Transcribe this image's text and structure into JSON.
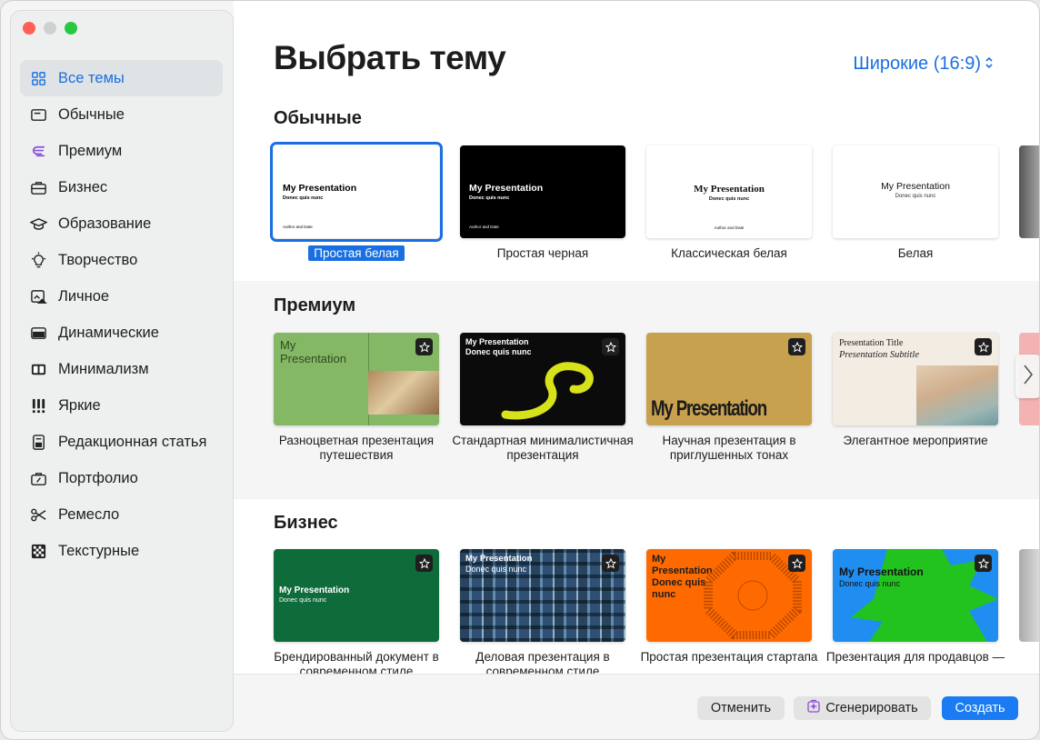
{
  "window": {
    "traffic_lights": [
      "close",
      "minimize",
      "maximize"
    ]
  },
  "sidebar": {
    "items": [
      {
        "label": "Все темы",
        "icon": "grid-icon"
      },
      {
        "label": "Обычные",
        "icon": "window-icon"
      },
      {
        "label": "Премиум",
        "icon": "premium-e-icon"
      },
      {
        "label": "Бизнес",
        "icon": "briefcase-icon"
      },
      {
        "label": "Образование",
        "icon": "graduation-cap-icon"
      },
      {
        "label": "Творчество",
        "icon": "lightbulb-icon"
      },
      {
        "label": "Личное",
        "icon": "personal-photo-icon"
      },
      {
        "label": "Динамические",
        "icon": "dynamic-slide-icon"
      },
      {
        "label": "Минимализм",
        "icon": "minimal-panels-icon"
      },
      {
        "label": "Яркие",
        "icon": "exclamation-icon"
      },
      {
        "label": "Редакционная статья",
        "icon": "document-icon"
      },
      {
        "label": "Портфолио",
        "icon": "portfolio-icon"
      },
      {
        "label": "Ремесло",
        "icon": "scissors-icon"
      },
      {
        "label": "Текстурные",
        "icon": "checkerboard-icon"
      }
    ]
  },
  "header": {
    "title": "Выбрать тему",
    "ratio": "Широкие (16:9)"
  },
  "sections": {
    "basic": {
      "title": "Обычные",
      "cards": [
        {
          "caption": "Простая белая",
          "t_title": "My Presentation",
          "t_sub": "Donec quis nunc",
          "t_foot": "Author and Date"
        },
        {
          "caption": "Простая черная",
          "t_title": "My Presentation",
          "t_sub": "Donec quis nunc",
          "t_foot": "Author and Date"
        },
        {
          "caption": "Классическая белая",
          "t_title": "My Presentation",
          "t_sub": "Donec quis nunc",
          "t_foot": "Author and Date"
        },
        {
          "caption": "Белая",
          "t_title": "My Presentation",
          "t_sub": "Donec quis nunc"
        }
      ]
    },
    "premium": {
      "title": "Премиум",
      "cards": [
        {
          "caption": "Разноцветная презентация путешествия",
          "t_title": "My Presentation"
        },
        {
          "caption": "Стандартная минималистичная презентация",
          "t_title": "My Presentation",
          "t_sub": "Donec quis nunc"
        },
        {
          "caption": "Научная презентация в приглушенных тонах",
          "t_title": "My Presentation"
        },
        {
          "caption": "Элегантное мероприятие",
          "t_title": "Presentation Title",
          "t_sub": "Presentation Subtitle"
        }
      ]
    },
    "business": {
      "title": "Бизнес",
      "cards": [
        {
          "caption": "Брендированный документ в современном стиле",
          "t_title": "My Presentation",
          "t_sub": "Donec quis nunc"
        },
        {
          "caption": "Деловая презентация в современном стиле",
          "t_title": "My Presentation",
          "t_sub": "Donec quis nunc"
        },
        {
          "caption": "Простая презентация стартапа",
          "t_title": "My Presentation Donec quis nunc"
        },
        {
          "caption": "Презентация для продавцов —",
          "t_title": "My Presentation",
          "t_sub": "Donec quis nunc"
        }
      ]
    }
  },
  "footer": {
    "cancel": "Отменить",
    "generate": "Сгенерировать",
    "create": "Создать"
  },
  "colors": {
    "accent": "#1a6fe0",
    "green": "#7fb35a",
    "gold": "#c9a24f",
    "orange": "#ff6a00",
    "brand_green": "#0e6b3a"
  }
}
